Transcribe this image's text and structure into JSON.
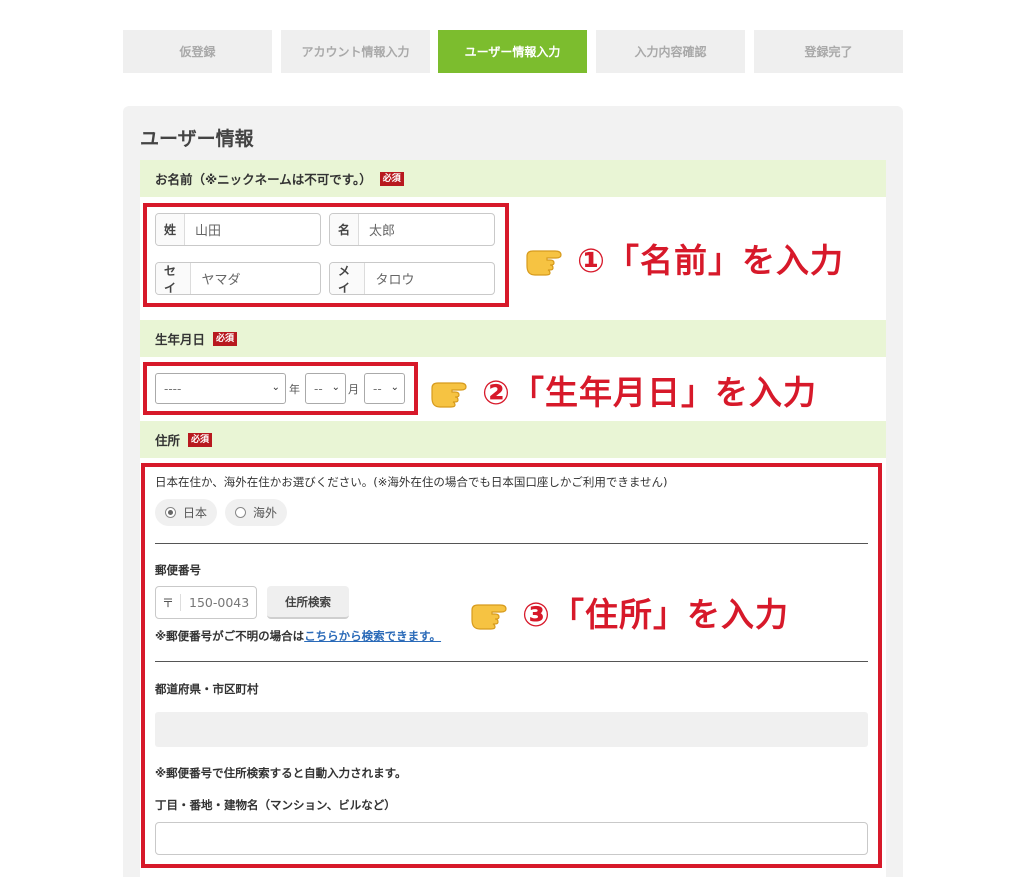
{
  "steps": [
    "仮登録",
    "アカウント情報入力",
    "ユーザー情報入力",
    "入力内容確認",
    "登録完了"
  ],
  "panel_title": "ユーザー情報",
  "required_badge": "必須",
  "name_section": {
    "heading": "お名前（※ニックネームは不可です。）",
    "fields": [
      {
        "label": "姓",
        "value": "山田"
      },
      {
        "label": "名",
        "value": "太郎"
      },
      {
        "label": "セイ",
        "value": "ヤマダ"
      },
      {
        "label": "メイ",
        "value": "タロウ"
      }
    ]
  },
  "birth_section": {
    "heading": "生年月日",
    "year_value": "----",
    "year_unit": "年",
    "month_value": "--",
    "month_unit": "月",
    "day_value": "--"
  },
  "address_section": {
    "heading": "住所",
    "residence_prompt": "日本在住か、海外在住かお選びください。(※海外在住の場合でも日本国口座しかご利用できません)",
    "radio_japan": "日本",
    "radio_overseas": "海外",
    "zip_label": "郵便番号",
    "zip_mark": "〒",
    "zip_value": "150-0043",
    "zip_search_button": "住所検索",
    "zip_note_prefix": "※郵便番号がご不明の場合は",
    "zip_note_link": "こちらから検索できます。",
    "pref_label": "都道府県・市区町村",
    "auto_note": "※郵便番号で住所検索すると自動入力されます。",
    "street_label": "丁目・番地・建物名（マンション、ビルなど）"
  },
  "annotations": {
    "name": "①「名前」を入力",
    "birth": "②「生年月日」を入力",
    "address": "③「住所」を入力"
  },
  "colors": {
    "accent_green": "#7cbd2e",
    "highlight_red": "#d7192a",
    "section_bg": "#e9f5d5"
  }
}
